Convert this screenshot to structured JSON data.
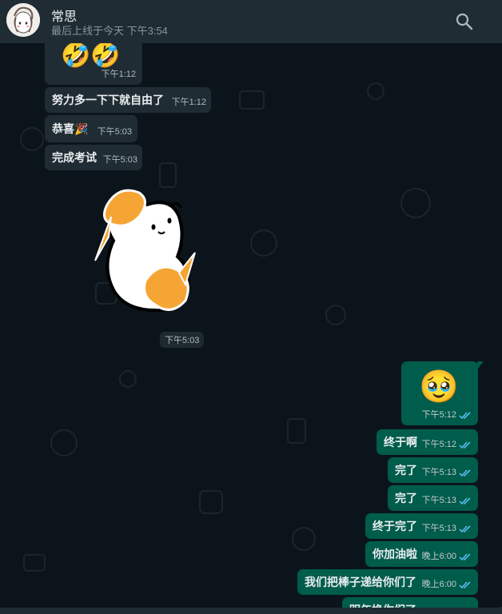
{
  "header": {
    "contact_name": "常思",
    "last_seen": "最后上线于今天 下午3:54"
  },
  "messages": [
    {
      "dir": "in",
      "text": "🤣🤣",
      "time": "下午1:12"
    },
    {
      "dir": "in",
      "text": "努力多一下下就自由了",
      "time": "下午1:12"
    },
    {
      "dir": "in",
      "text": "恭喜🎉",
      "time": "下午5:03"
    },
    {
      "dir": "in",
      "text": "完成考试",
      "time": "下午5:03"
    },
    {
      "dir": "in",
      "sticker": "cheerleader-sticker",
      "time": "下午5:03"
    },
    {
      "dir": "out",
      "text": "🥹",
      "time": "下午5:12"
    },
    {
      "dir": "out",
      "text": "终于啊",
      "time": "下午5:12"
    },
    {
      "dir": "out",
      "text": "完了",
      "time": "下午5:13"
    },
    {
      "dir": "out",
      "text": "完了",
      "time": "下午5:13"
    },
    {
      "dir": "out",
      "text": "终于完了",
      "time": "下午5:13"
    },
    {
      "dir": "out",
      "text": "你加油啦",
      "time": "晚上6:00"
    },
    {
      "dir": "out",
      "text": "我们把棒子递给你们了",
      "time": "晚上6:00"
    },
    {
      "dir": "out",
      "text": "明年换你们了",
      "time": ""
    }
  ],
  "colors": {
    "background": "#0b141a",
    "header": "#202c33",
    "incoming_bubble": "#202c33",
    "outgoing_bubble": "#005c4b",
    "read_ticks": "#53bdeb"
  },
  "icons": [
    "search-icon",
    "double-check-icon",
    "avatar"
  ]
}
